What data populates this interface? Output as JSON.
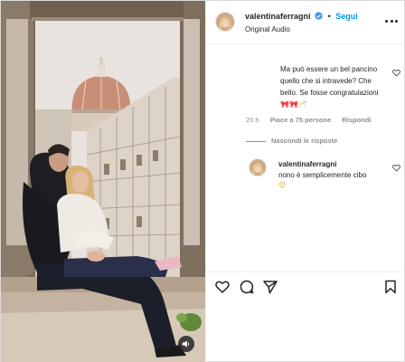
{
  "post": {
    "author": "valentinaferragni",
    "follow_label": "Segui",
    "separator": "•",
    "audio": "Original Audio"
  },
  "comments": {
    "first": {
      "text": "Ma può essere un bel pancino quello che si intravede? Che bello. Se fosse congratulazioni",
      "emoji": "🎀🎀🥂",
      "time": "20 h",
      "likes": "Piace a 75 persone",
      "reply_label": "Rispondi"
    },
    "hide_replies_label": "Nascondi le risposte",
    "reply": {
      "author": "valentinaferragni",
      "text": "nono è semplicemente cibo",
      "emoji": "😌"
    }
  },
  "icons": {
    "like": "heart-icon",
    "comment": "comment-icon",
    "share": "paper-plane-icon",
    "save": "bookmark-icon",
    "audio": "speaker-icon",
    "verified": "verified-badge-icon",
    "more": "more-options-icon"
  },
  "colors": {
    "accent": "#0095f6",
    "text": "#262626",
    "muted": "#8e8e8e",
    "border": "#dbdbdb"
  }
}
